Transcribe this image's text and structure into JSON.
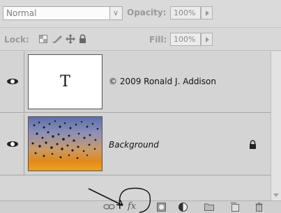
{
  "blend_mode": {
    "selected": "Normal"
  },
  "opacity": {
    "label": "Opacity:",
    "value": "100%"
  },
  "lock": {
    "label": "Lock:"
  },
  "fill": {
    "label": "Fill:",
    "value": "100%"
  },
  "layers": [
    {
      "name": "© 2009 Ronald J. Addison",
      "thumbnail_text": "T",
      "visible": true
    },
    {
      "name": "Background",
      "visible": true,
      "locked": true
    }
  ],
  "bottom_toolbar": {
    "fx_label": "fx"
  },
  "icons": [
    "chevron-down-icon",
    "triangle-right-icon",
    "lock-transparent-icon",
    "brush-icon",
    "move-icon",
    "lock-all-icon",
    "eye-icon",
    "lock-icon",
    "link-icon",
    "fx-icon",
    "mask-icon",
    "adjustment-layer-icon",
    "group-folder-icon",
    "new-layer-icon",
    "trash-icon"
  ]
}
